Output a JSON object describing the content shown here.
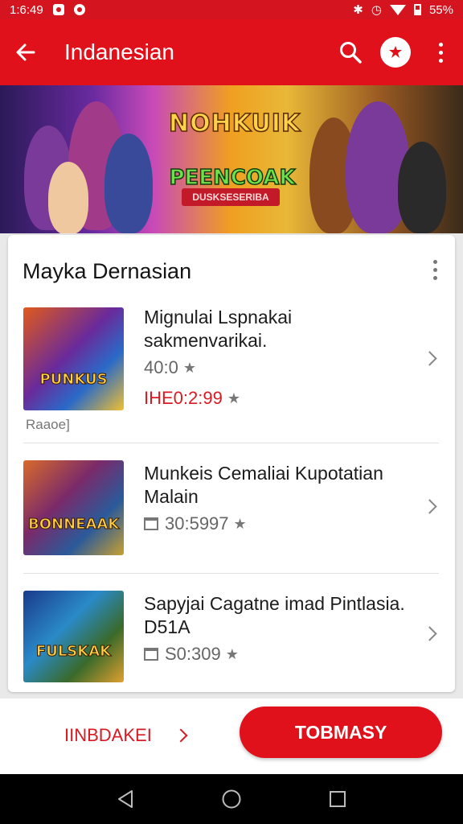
{
  "status_bar": {
    "time": "1:6:49",
    "battery": "55%"
  },
  "app_bar": {
    "title": "Indanesian",
    "icons": [
      "arrow-back-icon",
      "search-icon",
      "profile-badge-icon",
      "more-vert-icon"
    ]
  },
  "banner": {
    "title": "NOHKUIK",
    "subtitle": "PEENCOAK",
    "ribbon": "DUSKSESERIBA"
  },
  "section": {
    "title": "Mayka Dernasian",
    "items": [
      {
        "title": "Mignulai Lspnakai sakmenvarikai.",
        "rating": "40:0",
        "date": "IHE0:2:99",
        "tag": "Raaoe]",
        "thumb_label": "PUNKUS"
      },
      {
        "title": "Munkeis Cemaliai Kupotatian Malain",
        "date": "30:5997",
        "thumb_label": "BONNEAAK"
      },
      {
        "title": "Sapyjai Cagatne imad Pintlasia. D51A",
        "date": "S0:309",
        "thumb_label": "FULSKAK"
      }
    ]
  },
  "bottom_bar": {
    "secondary_label": "IINBDAKEI",
    "primary_label": "TOBMASY"
  },
  "colors": {
    "brand_red": "#e0111b",
    "status_red": "#d4141e",
    "accent_text_red": "#d81a22"
  }
}
